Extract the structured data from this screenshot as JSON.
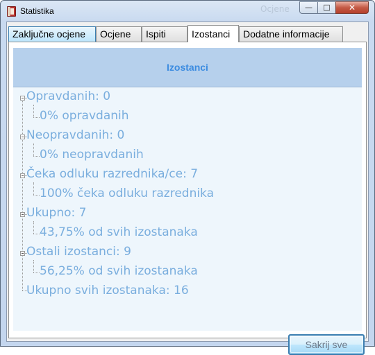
{
  "window": {
    "title": "Statistika",
    "ghost_title": "Ocjene"
  },
  "tabs": [
    {
      "label": "Zaključne ocjene"
    },
    {
      "label": "Ocjene"
    },
    {
      "label": "Ispiti"
    },
    {
      "label": "Izostanci"
    },
    {
      "label": "Dodatne informacije"
    }
  ],
  "active_tab": "Izostanci",
  "panel": {
    "header": "Izostanci"
  },
  "tree": {
    "opravdanih": {
      "label": "Opravdanih:  0",
      "child": "0% opravdanih"
    },
    "neopravdanih": {
      "label": "Neopravdanih:  0",
      "child": "0% neopravdanih"
    },
    "ceka": {
      "label": "Čeka odluku razrednika/ce:  7",
      "child": "100% čeka odluku razrednika"
    },
    "ukupno": {
      "label": "Ukupno:  7",
      "child": "43,75% od svih izostanaka"
    },
    "ostali": {
      "label": "Ostali izostanci:  9",
      "child": "56,25% od svih izostanaka"
    },
    "ukupno_svih": {
      "label": "Ukupno svih izostanaka: 16"
    }
  },
  "buttons": {
    "hide_all": "Sakrij sve"
  },
  "colors": {
    "header_bg": "#b6d0ec",
    "header_text": "#3b8be0",
    "tree_text": "#7aaede"
  }
}
